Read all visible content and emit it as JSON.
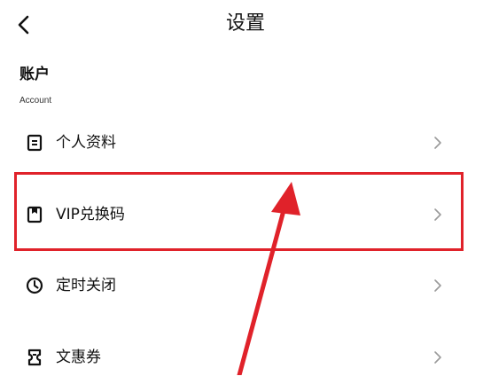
{
  "header": {
    "title": "设置",
    "back_icon": "chevron-left-icon"
  },
  "section": {
    "title": "账户",
    "subtitle": "Account"
  },
  "items": [
    {
      "label": "个人资料",
      "icon": "document-icon"
    },
    {
      "label": "VIP兑换码",
      "icon": "bookmark-icon"
    },
    {
      "label": "定时关闭",
      "icon": "clock-icon"
    },
    {
      "label": "文惠券",
      "icon": "ticket-icon"
    }
  ],
  "colors": {
    "annotation": "#e0222a",
    "chevron": "#9a9a9a",
    "text": "#111111"
  }
}
